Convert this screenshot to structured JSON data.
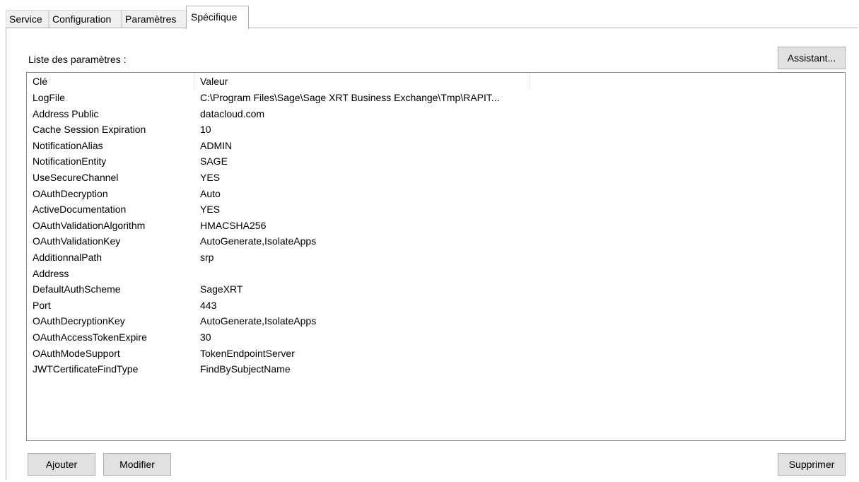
{
  "tabs": [
    "Service",
    "Configuration",
    "Paramètres",
    "Spécifique"
  ],
  "active_tab": "Spécifique",
  "list_label": "Liste des paramètres :",
  "buttons": {
    "assistant": "Assistant...",
    "add": "Ajouter",
    "modify": "Modifier",
    "delete": "Supprimer"
  },
  "columns": {
    "key": "Clé",
    "value": "Valeur"
  },
  "rows": [
    {
      "key": "LogFile",
      "value": "C:\\Program Files\\Sage\\Sage XRT Business Exchange\\Tmp\\RAPIT..."
    },
    {
      "key": "Address Public",
      "value": "datacloud.com"
    },
    {
      "key": "Cache Session Expiration",
      "value": "10"
    },
    {
      "key": "NotificationAlias",
      "value": "ADMIN"
    },
    {
      "key": "NotificationEntity",
      "value": "SAGE"
    },
    {
      "key": "UseSecureChannel",
      "value": "YES"
    },
    {
      "key": "OAuthDecryption",
      "value": "Auto"
    },
    {
      "key": "ActiveDocumentation",
      "value": "YES"
    },
    {
      "key": "OAuthValidationAlgorithm",
      "value": "HMACSHA256"
    },
    {
      "key": "OAuthValidationKey",
      "value": "AutoGenerate,IsolateApps"
    },
    {
      "key": "AdditionnalPath",
      "value": "srp"
    },
    {
      "key": "Address",
      "value": ""
    },
    {
      "key": "DefaultAuthScheme",
      "value": "SageXRT"
    },
    {
      "key": "Port",
      "value": "443"
    },
    {
      "key": "OAuthDecryptionKey",
      "value": "AutoGenerate,IsolateApps"
    },
    {
      "key": "OAuthAccessTokenExpire",
      "value": "30"
    },
    {
      "key": "OAuthModeSupport",
      "value": "TokenEndpointServer"
    },
    {
      "key": "JWTCertificateFindType",
      "value": "FindBySubjectName"
    }
  ]
}
